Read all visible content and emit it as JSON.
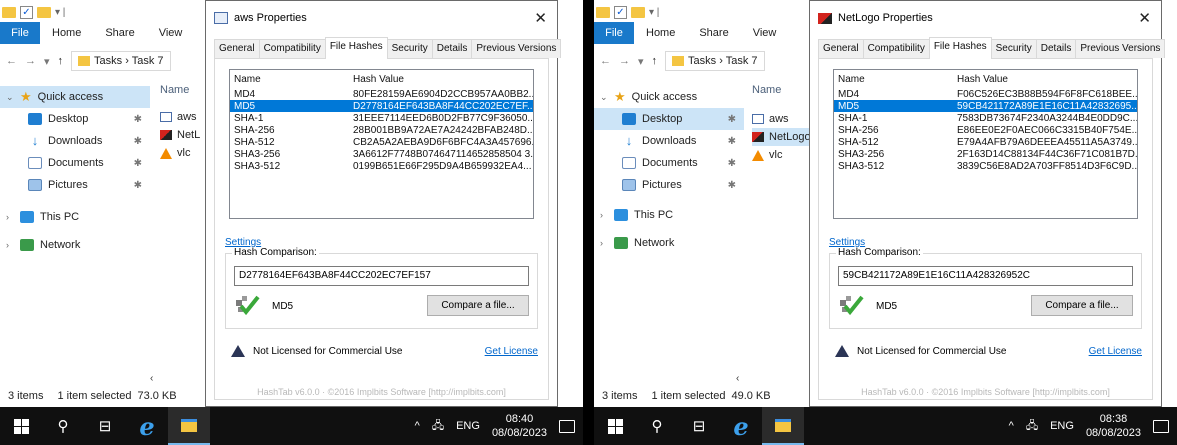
{
  "left": {
    "explorer": {
      "ribbon_tabs": [
        "File",
        "Home",
        "Share",
        "View"
      ],
      "address": {
        "crumbs": "Tasks  ›  Task 7"
      },
      "nav": {
        "quick_access": "Quick access",
        "desktop": "Desktop",
        "downloads": "Downloads",
        "documents": "Documents",
        "pictures": "Pictures",
        "this_pc": "This PC",
        "network": "Network"
      },
      "column_name": "Name",
      "files": [
        "aws",
        "NetL",
        "vlc"
      ],
      "status_items": "3 items",
      "status_selected": "1 item selected",
      "status_size": "73.0 KB"
    },
    "dialog": {
      "title": "aws Properties",
      "tabs": [
        "General",
        "Compatibility",
        "File Hashes",
        "Security",
        "Details",
        "Previous Versions"
      ],
      "col_name": "Name",
      "col_hash": "Hash Value",
      "hashes": [
        {
          "name": "MD4",
          "value": "80FE28159AE6904D2CCB957AA0BB2..."
        },
        {
          "name": "MD5",
          "value": "D2778164EF643BA8F44CC202EC7EF..."
        },
        {
          "name": "SHA-1",
          "value": "31EEE7114EED6B0D2FB77C9F36050..."
        },
        {
          "name": "SHA-256",
          "value": "28B001BB9A72AE7A24242BFAB248D..."
        },
        {
          "name": "SHA-512",
          "value": "CB2A5A2AEBA9D6F6BFC4A3A457696..."
        },
        {
          "name": "SHA3-256",
          "value": "3A6612F7748B074647114652858504 3..."
        },
        {
          "name": "SHA3-512",
          "value": "0199B651E66F295D9A4B659932EA4..."
        }
      ],
      "settings": "Settings",
      "compare_label": "Hash Comparison:",
      "compare_value": "D2778164EF643BA8F44CC202EC7EF157",
      "match_alg": "MD5",
      "compare_btn": "Compare a file...",
      "license_text": "Not Licensed for Commercial Use",
      "get_license": "Get License",
      "footer": "HashTab v6.0.0 · ©2016 Implbits Software [http://implbits.com]"
    },
    "taskbar": {
      "lang": "ENG",
      "time": "08:40",
      "date": "08/08/2023"
    }
  },
  "right": {
    "explorer": {
      "ribbon_tabs": [
        "File",
        "Home",
        "Share",
        "View"
      ],
      "address": {
        "crumbs": "Tasks  ›  Task 7"
      },
      "nav": {
        "quick_access": "Quick access",
        "desktop": "Desktop",
        "downloads": "Downloads",
        "documents": "Documents",
        "pictures": "Pictures",
        "this_pc": "This PC",
        "network": "Network"
      },
      "column_name": "Name",
      "files": [
        "aws",
        "NetLogo",
        "vlc"
      ],
      "status_items": "3 items",
      "status_selected": "1 item selected",
      "status_size": "49.0 KB"
    },
    "dialog": {
      "title": "NetLogo Properties",
      "tabs": [
        "General",
        "Compatibility",
        "File Hashes",
        "Security",
        "Details",
        "Previous Versions"
      ],
      "col_name": "Name",
      "col_hash": "Hash Value",
      "hashes": [
        {
          "name": "MD4",
          "value": "F06C526EC3B88B594F6F8FC618BEE..."
        },
        {
          "name": "MD5",
          "value": "59CB421172A89E1E16C11A42832695..."
        },
        {
          "name": "SHA-1",
          "value": "7583DB73674F2340A3244B4E0DD9C..."
        },
        {
          "name": "SHA-256",
          "value": "E86EE0E2F0AEC066C3315B40F754E..."
        },
        {
          "name": "SHA-512",
          "value": "E79A4AFB79A6DEEEA45511A5A3749..."
        },
        {
          "name": "SHA3-256",
          "value": "2F163D14C88134F44C36F71C081B7D..."
        },
        {
          "name": "SHA3-512",
          "value": "3839C56E8AD2A703FF8514D3F6C9D..."
        }
      ],
      "settings": "Settings",
      "compare_label": "Hash Comparison:",
      "compare_value": "59CB421172A89E1E16C11A428326952C",
      "match_alg": "MD5",
      "compare_btn": "Compare a file...",
      "license_text": "Not Licensed for Commercial Use",
      "get_license": "Get License",
      "footer": "HashTab v6.0.0 · ©2016 Implbits Software [http://implbits.com]"
    },
    "taskbar": {
      "lang": "ENG",
      "time": "08:38",
      "date": "08/08/2023"
    }
  }
}
